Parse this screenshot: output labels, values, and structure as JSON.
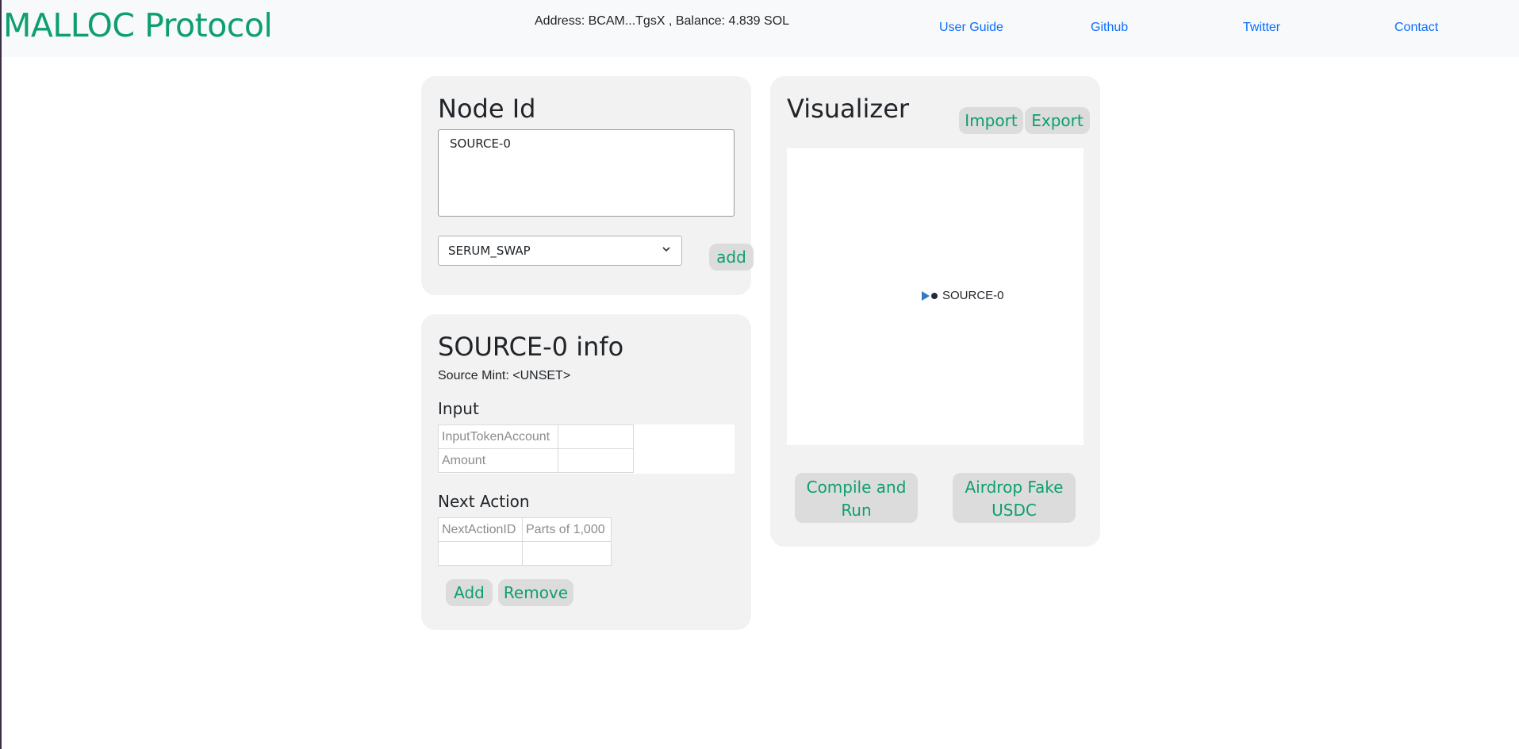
{
  "header": {
    "brand": "MALLOC Protocol",
    "wallet_text": "Address: BCAM...TgsX , Balance: 4.839 SOL",
    "nav": [
      "User Guide",
      "Github",
      "Twitter",
      "Contact"
    ]
  },
  "node_panel": {
    "title": "Node Id",
    "node_id_value": "SOURCE-0",
    "action_select_value": "SERUM_SWAP",
    "add_label": "add"
  },
  "info_panel": {
    "title": "SOURCE-0 info",
    "source_mint": "Source Mint: <UNSET>",
    "input_heading": "Input",
    "input_rows": [
      "InputTokenAccount",
      "Amount"
    ],
    "next_action_heading": "Next Action",
    "next_action_headers": [
      "NextActionID",
      "Parts of 1,000"
    ],
    "add_label": "Add",
    "remove_label": "Remove"
  },
  "visualizer": {
    "title": "Visualizer",
    "import_label": "Import",
    "export_label": "Export",
    "node_label": "SOURCE-0",
    "compile_label_1": "Compile and",
    "compile_label_2": "Run",
    "airdrop_label_1": "Airdrop Fake",
    "airdrop_label_2": "USDC"
  },
  "colors": {
    "accent_green": "#0d9f6e",
    "link_blue": "#0d6efd",
    "panel_bg": "#f2f2f2"
  }
}
